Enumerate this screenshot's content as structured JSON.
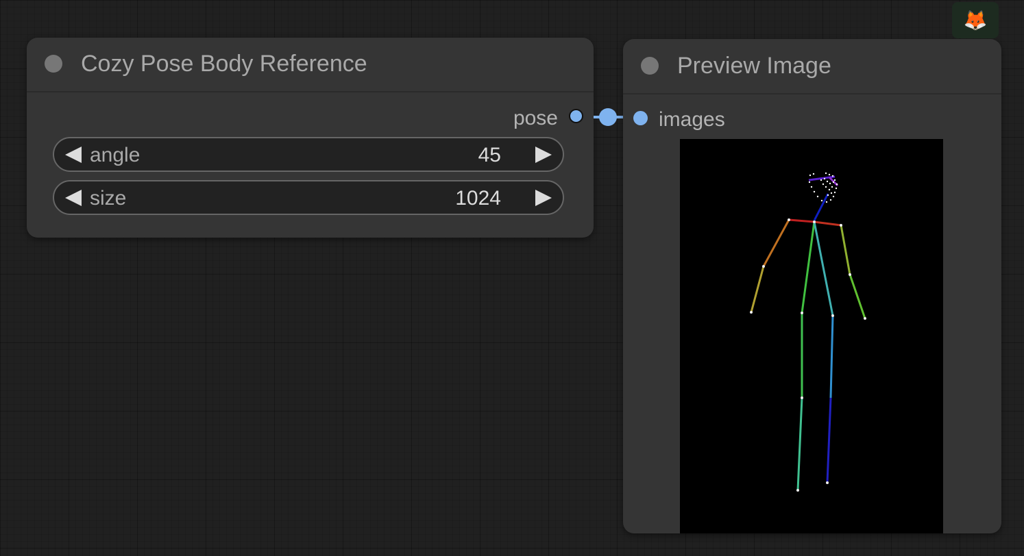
{
  "nodes": {
    "pose_node": {
      "title": "Cozy Pose Body Reference",
      "output_label": "pose",
      "widgets": [
        {
          "label": "angle",
          "value": "45"
        },
        {
          "label": "size",
          "value": "1024"
        }
      ]
    },
    "preview_node": {
      "title": "Preview Image",
      "input_label": "images"
    }
  },
  "toolbar": {
    "fox_icon": "🦊"
  },
  "colors": {
    "link": "#7fb3ef",
    "node_bg": "#353535",
    "canvas_bg": "#202020"
  },
  "icons": [
    "node-status-dot-icon",
    "decrement-arrow-icon",
    "increment-arrow-icon",
    "fox-icon"
  ]
}
